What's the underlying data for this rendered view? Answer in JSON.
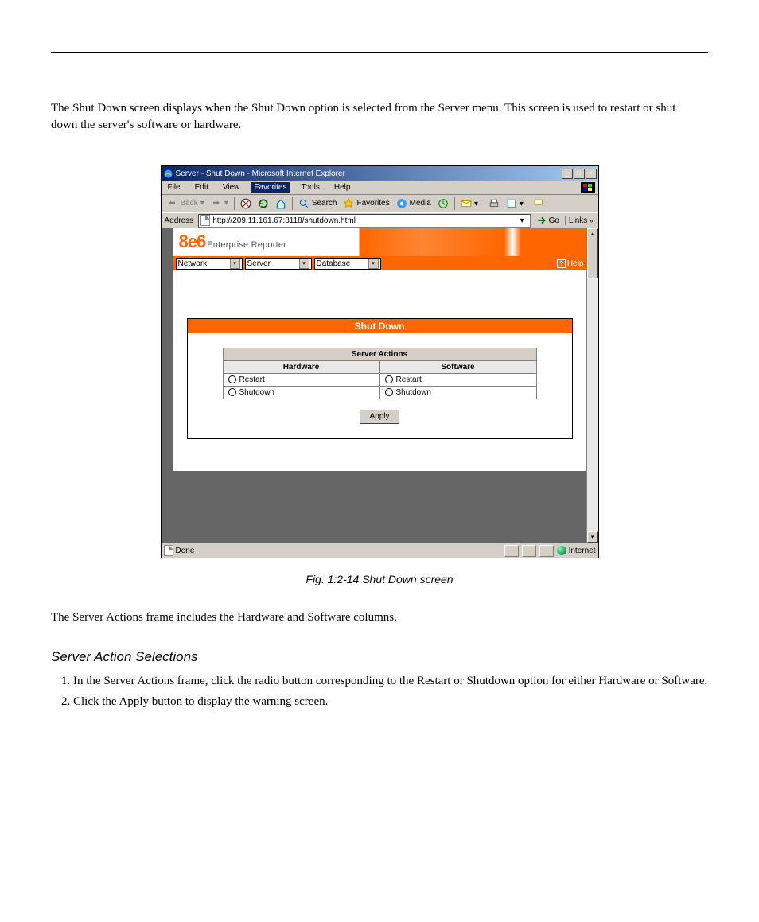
{
  "doc": {
    "intro": "The Shut Down screen displays when the Shut Down option is selected from the Server menu. This screen is used to restart or shut down the server's software or hardware.",
    "caption": "Fig. 1:2-14  Shut Down screen",
    "body": "The Server Actions frame includes the Hardware and Software columns.",
    "section": "Server Action Selections",
    "steps": [
      "In the Server Actions frame, click the radio button corresponding to the Restart or Shutdown option for either Hardware or Software.",
      "Click the Apply button to display the warning screen."
    ]
  },
  "ie": {
    "title": "Server - Shut Down - Microsoft Internet Explorer",
    "menu": [
      "File",
      "Edit",
      "View",
      "Favorites",
      "Tools",
      "Help"
    ],
    "toolbar": {
      "back": "Back",
      "search": "Search",
      "favorites": "Favorites",
      "media": "Media"
    },
    "address_label": "Address",
    "url": "http://209.11.161.67:8118/shutdown.html",
    "go": "Go",
    "links": "Links",
    "status": "Done",
    "zone": "Internet"
  },
  "app": {
    "brand": "8e6",
    "product": "Enterprise Reporter",
    "nav": [
      "Network",
      "Server",
      "Database"
    ],
    "help": "Help"
  },
  "panel": {
    "title": "Shut Down",
    "table_header": "Server Actions",
    "cols": [
      "Hardware",
      "Software"
    ],
    "options": {
      "restart": "Restart",
      "shutdown": "Shutdown"
    },
    "apply": "Apply"
  }
}
